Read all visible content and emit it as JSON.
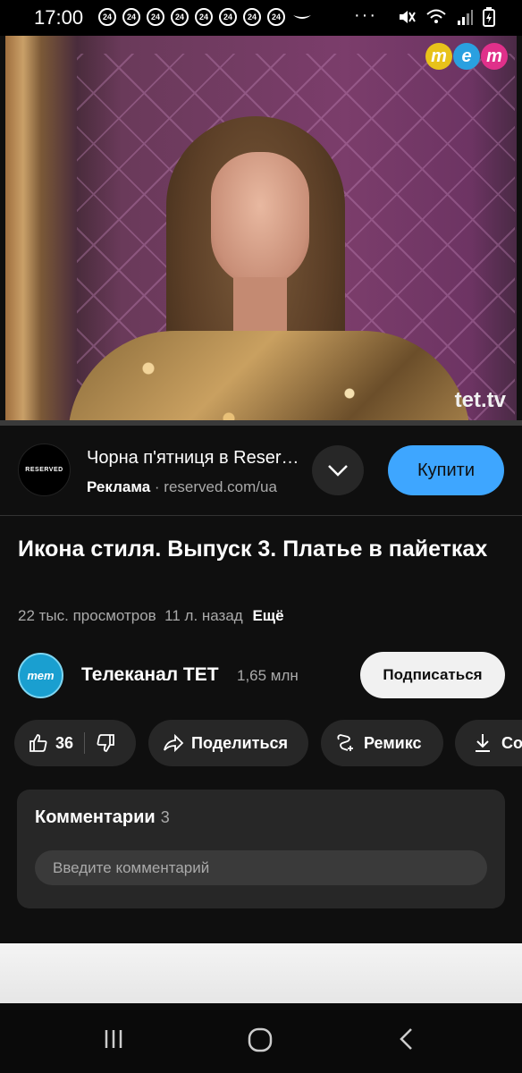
{
  "status_bar": {
    "time": "17:00",
    "badges": [
      "24",
      "24",
      "24",
      "24",
      "24",
      "24",
      "24",
      "24"
    ],
    "more": "···"
  },
  "video": {
    "channel_logo_letters": [
      "т",
      "е",
      "т"
    ],
    "watermark": "tet.tv",
    "progress_fraction": 0.0
  },
  "ad": {
    "logo_text": "RESERVED",
    "title": "Чорна п'ятниця в Reserved",
    "sponsored_label": "Реклама",
    "url": "reserved.com/ua",
    "buy_label": "Купити"
  },
  "video_info": {
    "title": "Икона стиля. Выпуск 3. Платье в пайетках",
    "views": "22 тыс. просмотров",
    "age": "11 л. назад",
    "more_label": "Ещё"
  },
  "channel": {
    "avatar_text": "тет",
    "name": "Телеканал ТЕТ",
    "subscribers": "1,65 млн",
    "subscribe_label": "Подписаться"
  },
  "actions": {
    "likes": "36",
    "share_label": "Поделиться",
    "remix_label": "Ремикс",
    "save_label": "Сохранить"
  },
  "comments": {
    "heading": "Комментарии",
    "count": "3",
    "placeholder": "Введите комментарий"
  },
  "colors": {
    "accent_blue": "#3ea6ff",
    "background": "#0f0f0f",
    "pill": "#272727"
  }
}
